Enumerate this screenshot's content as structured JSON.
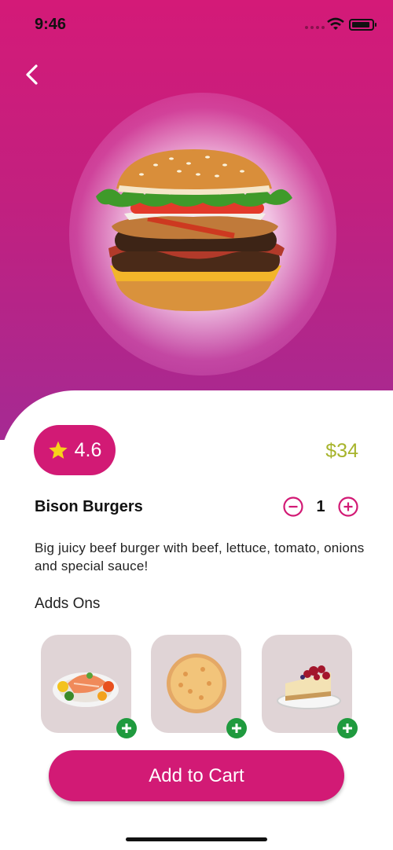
{
  "status_bar": {
    "time": "9:46"
  },
  "product": {
    "rating": "4.6",
    "price": "$34",
    "name": "Bison Burgers",
    "quantity": "1",
    "description": "Big juicy beef burger with beef, lettuce, tomato, onions and special sauce!"
  },
  "addons": {
    "title": "Adds Ons",
    "items": [
      {
        "icon": "salmon-plate-icon"
      },
      {
        "icon": "pizza-icon"
      },
      {
        "icon": "cheesecake-icon"
      }
    ]
  },
  "actions": {
    "add_to_cart": "Add to Cart"
  },
  "colors": {
    "accent": "#d21a75",
    "price": "#a7b42c",
    "plus": "#1f9a3e",
    "addon_bg": "#e0d4d6"
  }
}
